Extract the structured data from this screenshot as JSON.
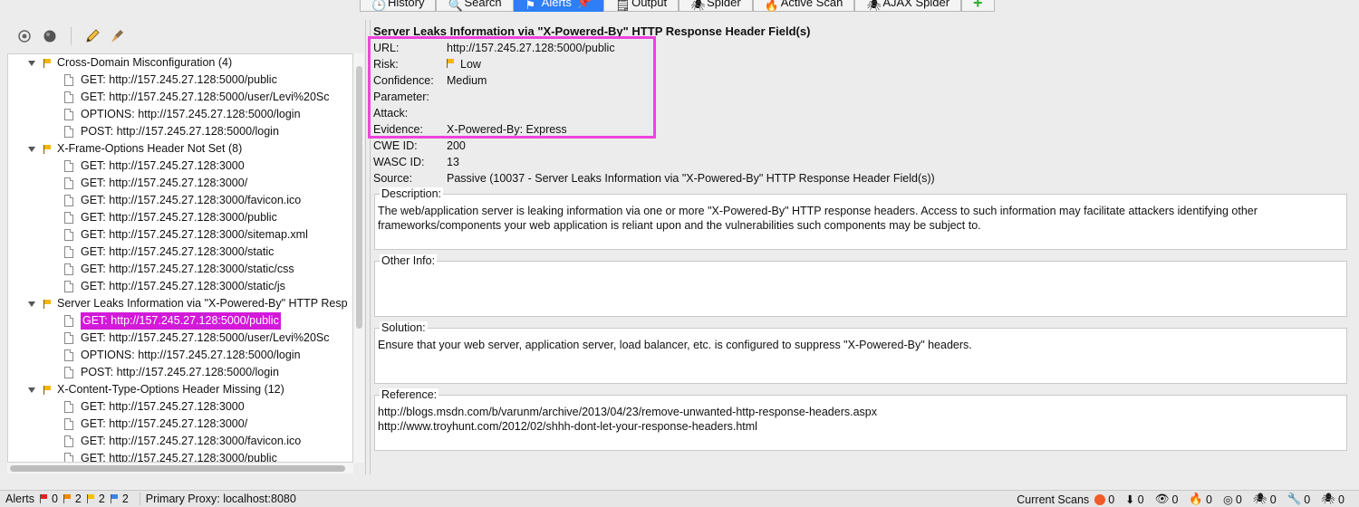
{
  "tabs": [
    {
      "label": "History",
      "icon": "history-icon",
      "active": false
    },
    {
      "label": "Search",
      "icon": "search-icon",
      "active": false
    },
    {
      "label": "Alerts",
      "icon": "alerts-flag-icon",
      "active": true
    },
    {
      "label": "Output",
      "icon": "output-icon",
      "active": false
    },
    {
      "label": "Spider",
      "icon": "spider-icon",
      "active": false
    },
    {
      "label": "Active Scan",
      "icon": "active-scan-icon",
      "active": false
    },
    {
      "label": "AJAX Spider",
      "icon": "ajax-spider-icon",
      "active": false
    }
  ],
  "tree": {
    "categories": [
      {
        "label": "Cross-Domain Misconfiguration (4)",
        "items": [
          "GET: http://157.245.27.128:5000/public",
          "GET: http://157.245.27.128:5000/user/Levi%20Sc",
          "OPTIONS: http://157.245.27.128:5000/login",
          "POST: http://157.245.27.128:5000/login"
        ]
      },
      {
        "label": "X-Frame-Options Header Not Set (8)",
        "items": [
          "GET: http://157.245.27.128:3000",
          "GET: http://157.245.27.128:3000/",
          "GET: http://157.245.27.128:3000/favicon.ico",
          "GET: http://157.245.27.128:3000/public",
          "GET: http://157.245.27.128:3000/sitemap.xml",
          "GET: http://157.245.27.128:3000/static",
          "GET: http://157.245.27.128:3000/static/css",
          "GET: http://157.245.27.128:3000/static/js"
        ]
      },
      {
        "label": "Server Leaks Information via \"X-Powered-By\" HTTP Resp",
        "items": [
          "GET: http://157.245.27.128:5000/public",
          "GET: http://157.245.27.128:5000/user/Levi%20Sc",
          "OPTIONS: http://157.245.27.128:5000/login",
          "POST: http://157.245.27.128:5000/login"
        ],
        "selected_index": 0
      },
      {
        "label": "X-Content-Type-Options Header Missing (12)",
        "items": [
          "GET: http://157.245.27.128:3000",
          "GET: http://157.245.27.128:3000/",
          "GET: http://157.245.27.128:3000/favicon.ico",
          "GET: http://157.245.27.128:3000/public"
        ]
      }
    ]
  },
  "detail": {
    "title": "Server Leaks Information via \"X-Powered-By\" HTTP Response Header Field(s)",
    "fields": [
      {
        "key": "URL:",
        "value": "http://157.245.27.128:5000/public"
      },
      {
        "key": "Risk:",
        "value": "Low",
        "flag": true
      },
      {
        "key": "Confidence:",
        "value": "Medium"
      },
      {
        "key": "Parameter:",
        "value": ""
      },
      {
        "key": "Attack:",
        "value": ""
      },
      {
        "key": "Evidence:",
        "value": "X-Powered-By: Express"
      },
      {
        "key": "CWE ID:",
        "value": "200"
      },
      {
        "key": "WASC ID:",
        "value": "13"
      },
      {
        "key": "Source:",
        "value": "Passive (10037 - Server Leaks Information via \"X-Powered-By\" HTTP Response Header Field(s))"
      }
    ],
    "description_label": "Description:",
    "description": "The web/application server is leaking information via one or more \"X-Powered-By\" HTTP response headers. Access to such information may facilitate attackers identifying other frameworks/components your web application is reliant upon and the vulnerabilities such components may be subject to.",
    "other_info_label": "Other Info:",
    "other_info": "",
    "solution_label": "Solution:",
    "solution": "Ensure that your web server, application server, load balancer, etc. is configured to suppress \"X-Powered-By\" headers.",
    "reference_label": "Reference:",
    "references": [
      "http://blogs.msdn.com/b/varunm/archive/2013/04/23/remove-unwanted-http-response-headers.aspx",
      "http://www.troyhunt.com/2012/02/shhh-dont-let-your-response-headers.html"
    ]
  },
  "status": {
    "alerts_label": "Alerts",
    "counts": [
      {
        "value": "0",
        "color": "#e02020"
      },
      {
        "value": "2",
        "color": "#f08a00"
      },
      {
        "value": "2",
        "color": "#f2c200"
      },
      {
        "value": "2",
        "color": "#3b83e6"
      }
    ],
    "proxy": "Primary Proxy: localhost:8080",
    "current_scans_label": "Current Scans",
    "scan_counts": [
      "0",
      "0",
      "0",
      "0",
      "0",
      "0",
      "0",
      "0"
    ]
  },
  "colors": {
    "accent": "#2d7ef7",
    "selection": "#d21ad8",
    "highlight_box": "#ee44dd"
  }
}
